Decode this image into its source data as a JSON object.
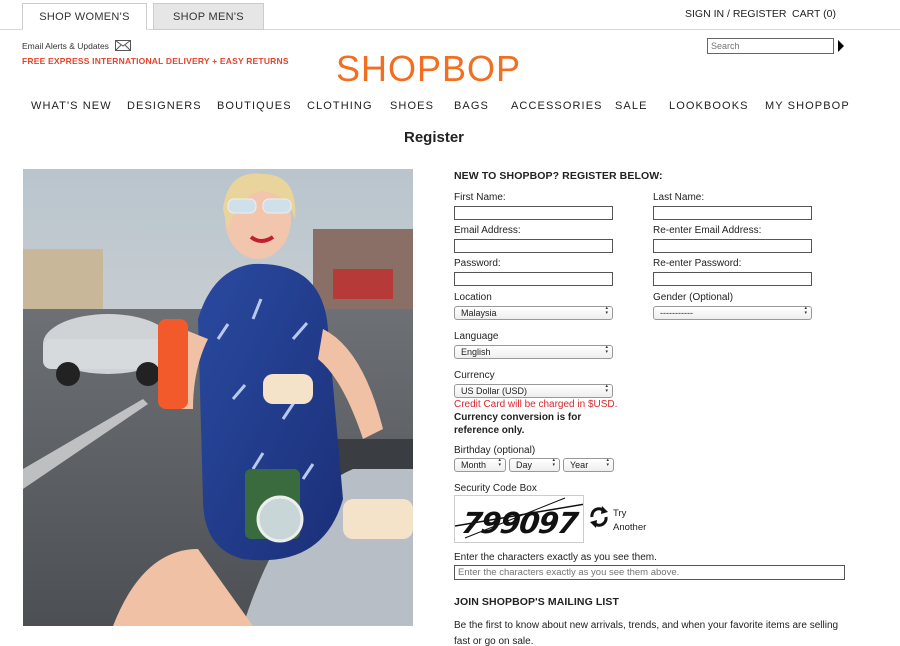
{
  "tabs": {
    "women": "SHOP WOMEN'S",
    "men": "SHOP MEN'S"
  },
  "header": {
    "signin": "SIGN IN / REGISTER",
    "cart": "CART (0)",
    "email_alerts": "Email Alerts & Updates",
    "promo": "FREE EXPRESS INTERNATIONAL DELIVERY + EASY RETURNS",
    "logo": "SHOPBOP",
    "search_placeholder": "Search"
  },
  "nav": [
    "WHAT'S NEW",
    "DESIGNERS",
    "BOUTIQUES",
    "CLOTHING",
    "SHOES",
    "BAGS",
    "ACCESSORIES",
    "SALE",
    "LOOKBOOKS",
    "MY SHOPBOP"
  ],
  "page_title": "Register",
  "form": {
    "heading": "NEW TO SHOPBOP? REGISTER BELOW:",
    "first_name": "First Name:",
    "last_name": "Last Name:",
    "email": "Email Address:",
    "reenter_email": "Re-enter Email Address:",
    "password": "Password:",
    "reenter_password": "Re-enter Password:",
    "location_label": "Location",
    "location_value": "Malaysia",
    "gender_label": "Gender (Optional)",
    "gender_value": "-----------",
    "language_label": "Language",
    "language_value": "English",
    "currency_label": "Currency",
    "currency_value": "US Dollar (USD)",
    "currency_error": "Credit Card will be charged in $USD.",
    "currency_note": "Currency conversion is for reference only.",
    "birthday_label": "Birthday (optional)",
    "month": "Month",
    "day": "Day",
    "year": "Year",
    "security_label": "Security Code Box",
    "captcha_text": "799097",
    "try_line1": "Try",
    "try_line2": "Another",
    "captcha_instructions": "Enter the characters exactly as you see them.",
    "captcha_placeholder": "Enter the characters exactly as you see them above."
  },
  "mailing": {
    "heading": "JOIN SHOPBOP'S MAILING LIST",
    "text": "Be the first to know about new arrivals, trends, and when your favorite items are selling fast or go on sale."
  },
  "colors": {
    "brand": "#f26f21",
    "promo": "#e4432c",
    "error": "#d9272e"
  }
}
